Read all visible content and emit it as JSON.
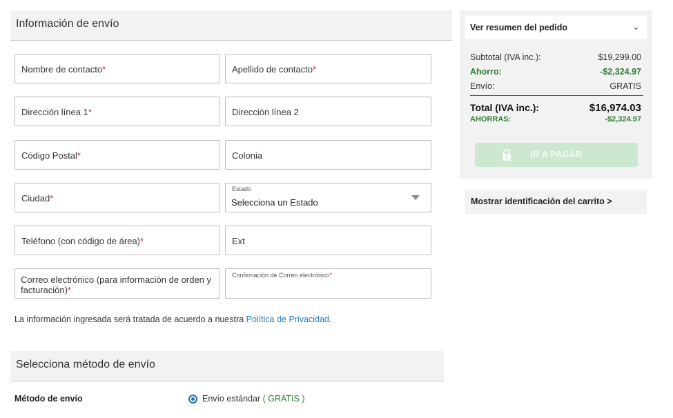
{
  "shipping": {
    "title": "Información de envío",
    "fields": {
      "first_name": {
        "label": "Nombre de contacto",
        "req": "*"
      },
      "last_name": {
        "label": "Apellido de contacto",
        "req": "*"
      },
      "address1": {
        "label": "Dirección línea 1",
        "req": "*"
      },
      "address2": {
        "label": "Dirección línea 2"
      },
      "postal": {
        "label": "Código Postal",
        "req": "*"
      },
      "colonia": {
        "label": "Colonia"
      },
      "city": {
        "label": "Ciudad",
        "req": "*"
      },
      "state": {
        "label": "Estado",
        "value": "Selecciona un Estado"
      },
      "phone": {
        "label": "Teléfono (con código de área)",
        "req": "*"
      },
      "ext": {
        "label": "Ext"
      },
      "email": {
        "label": "Correo electrónico (para información de orden y facturación)",
        "req": "*"
      },
      "email_confirm": {
        "label": "Confirmación de Correo electrónico",
        "req": "*"
      }
    },
    "privacy_text": "La información ingresada será tratada de acuerdo a nuestra",
    "privacy_link": "Política de Privacidad",
    "privacy_end": "."
  },
  "method": {
    "title": "Selecciona método de envío",
    "label": "Método de envío",
    "option": "Envío estándar",
    "option_price_open": "(",
    "option_price": "GRATIS",
    "option_price_close": ")"
  },
  "summary": {
    "toggle_label": "Ver resumen del pedido",
    "toggle_icon": "chevron-down-icon",
    "subtotal_label": "Subtotal (IVA inc.):",
    "subtotal_value": "$19,299.00",
    "savings_label": "Ahorro:",
    "savings_value": "-$2,324.97",
    "shipping_label": "Envío:",
    "shipping_value": "GRATIS",
    "total_label": "Total (IVA inc.):",
    "total_value": "$16,974.03",
    "you_save_label": "AHORRAS:",
    "you_save_value": "-$2,324.97",
    "pay_button": "IR A PAGAR",
    "pay_icon": "lock-icon"
  },
  "cart_id_link": "Mostrar identificación del carrito >",
  "colors": {
    "accent_green": "#2e7d32",
    "link_blue": "#1a7fbf",
    "pay_button_disabled": "#cde8d0"
  }
}
